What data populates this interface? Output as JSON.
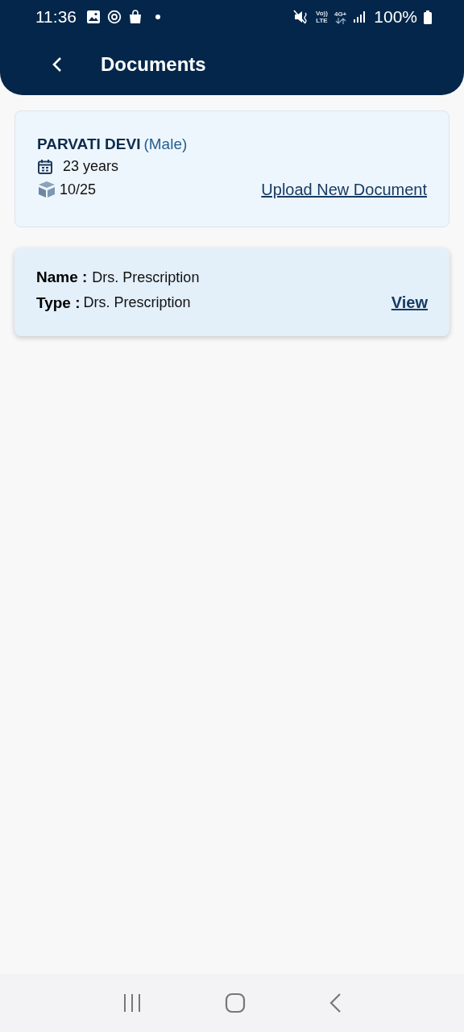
{
  "status_bar": {
    "time": "11:36",
    "volte_top": "Vo))",
    "volte_bottom": "LTE",
    "network": "4G+",
    "battery": "100%"
  },
  "app_bar": {
    "title": "Documents"
  },
  "patient": {
    "name": "PARVATI DEVI",
    "gender": "(Male)",
    "age": "23 years",
    "count": "10/25",
    "upload_link": "Upload New Document"
  },
  "documents": [
    {
      "name_label": "Name :",
      "name": "Drs. Prescription",
      "type_label": "Type :",
      "type": "Drs. Prescription",
      "view_link": "View"
    }
  ]
}
